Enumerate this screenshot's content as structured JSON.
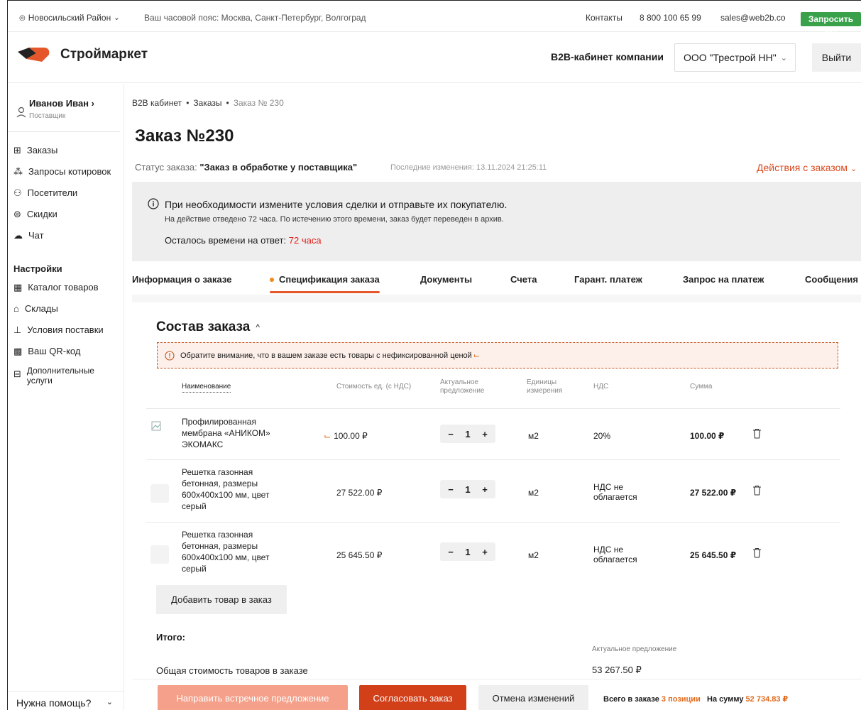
{
  "topbar": {
    "region": "Новосильский Район",
    "timezone": "Ваш часовой пояс: Москва, Санкт-Петербург, Волгоград",
    "contacts": "Контакты",
    "phone": "8 800 100 65 99",
    "email": "sales@web2b.co",
    "request_kp": "Запросить КП"
  },
  "header": {
    "logo_text": "Строймаркет",
    "b2b_title": "B2B-кабинет компании",
    "company": "ООО \"Трестрой НН\"",
    "logout": "Выйти"
  },
  "sidebar": {
    "user_name": "Иванов Иван ›",
    "user_role": "Поставщик",
    "items": [
      {
        "label": "Заказы",
        "icon": "orders-icon"
      },
      {
        "label": "Запросы котировок",
        "icon": "quotes-icon"
      },
      {
        "label": "Посетители",
        "icon": "visitors-icon"
      },
      {
        "label": "Скидки",
        "icon": "discounts-icon"
      },
      {
        "label": "Чат",
        "icon": "chat-icon"
      }
    ],
    "settings_heading": "Настройки",
    "settings_items": [
      {
        "label": "Каталог товаров",
        "icon": "catalog-icon"
      },
      {
        "label": "Склады",
        "icon": "warehouse-icon"
      },
      {
        "label": "Условия поставки",
        "icon": "delivery-icon"
      },
      {
        "label": "Ваш QR-код",
        "icon": "qr-icon"
      },
      {
        "label": "Дополнительные услуги",
        "icon": "services-icon"
      }
    ],
    "help": "Нужна помощь?"
  },
  "breadcrumb": [
    "B2B кабинет",
    "Заказы",
    "Заказ № 230"
  ],
  "page_title": "Заказ №230",
  "status": {
    "label": "Статус заказа:",
    "value": "\"Заказ в обработке у поставщика\"",
    "last_change": "Последние изменения: 13.11.2024 21:25:11",
    "actions": "Действия с заказом"
  },
  "notice": {
    "line1": "При необходимости измените условия сделки и отправьте их покупателю.",
    "line2": "На действие отведено 72 часа. По истечению этого времени, заказ будет переведен в архив.",
    "line3_label": "Осталось времени на ответ:",
    "line3_value": "72 часа"
  },
  "tabs": [
    "Информация о заказе",
    "Спецификация заказа",
    "Документы",
    "Счета",
    "Гарант. платеж",
    "Запрос на платеж",
    "Сообщения"
  ],
  "active_tab": "Спецификация заказа",
  "composition": {
    "title": "Состав заказа",
    "warning": "Обратите внимание, что в вашем заказе есть товары с нефиксированной ценой",
    "columns": {
      "name": "Наименование",
      "unit_price": "Стоимость ед. (с НДС)",
      "actual": "Актуальное предложение",
      "units": "Единицы измерения",
      "vat": "НДС",
      "sum": "Сумма"
    },
    "rows": [
      {
        "name": "Профилированная мембрана «АНИКОМ» ЭКОМАКС",
        "price": "100.00 ₽",
        "qty": "1",
        "unit": "м2",
        "vat": "20%",
        "sum": "100.00 ₽"
      },
      {
        "name": "Решетка газонная бетонная, размеры 600x400x100 мм, цвет серый",
        "price": "27 522.00 ₽",
        "qty": "1",
        "unit": "м2",
        "vat": "НДС не облагается",
        "sum": "27 522.00 ₽"
      },
      {
        "name": "Решетка газонная бетонная, размеры 600x400x100 мм, цвет серый",
        "price": "25 645.50 ₽",
        "qty": "1",
        "unit": "м2",
        "vat": "НДС не облагается",
        "sum": "25 645.50 ₽"
      }
    ],
    "add_button": "Добавить товар в заказ",
    "total_title": "Итого:",
    "actual_label": "Актуальное предложение",
    "total_label": "Общая стоимость товаров в заказе",
    "total_value": "53 267.50 ₽"
  },
  "bottom_bar": {
    "counter_offer": "Направить встречное предложение",
    "agree": "Согласовать заказ",
    "cancel": "Отмена изменений",
    "total_prefix": "Всего в заказе",
    "positions": "3 позиции",
    "sum_prefix": "На сумму",
    "sum": "52 734.83 ₽"
  },
  "colors": {
    "accent": "#d2401a",
    "accent_light": "#f4a08a",
    "green": "#3aa14b",
    "orange": "#e06a1d",
    "red": "#e0201b"
  }
}
